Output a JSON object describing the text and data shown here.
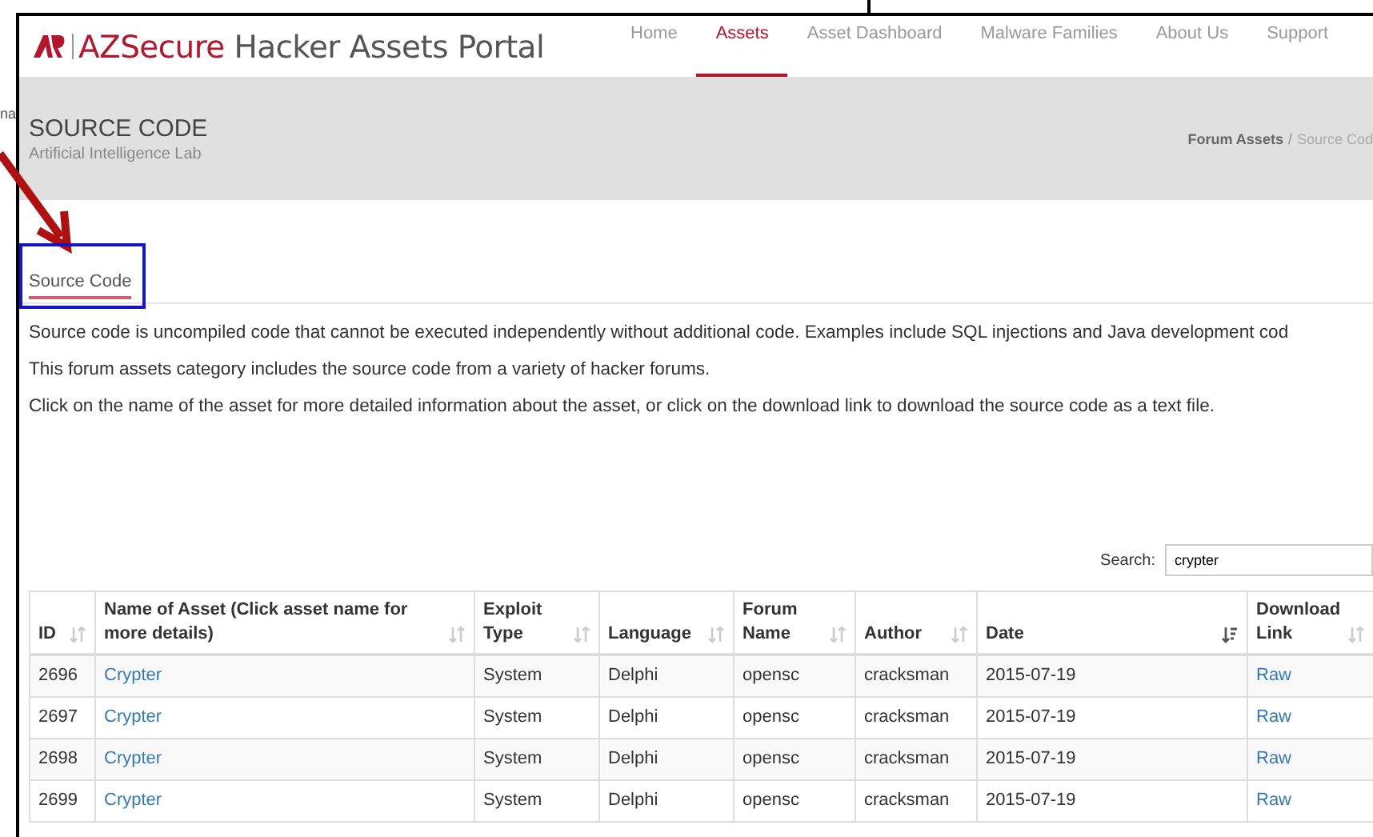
{
  "outside_text": "na",
  "brand": {
    "name": "AZSecure",
    "title": "Hacker Assets Portal"
  },
  "nav": [
    {
      "label": "Home",
      "selected": false
    },
    {
      "label": "Assets",
      "selected": true
    },
    {
      "label": "Asset Dashboard",
      "selected": false
    },
    {
      "label": "Malware Families",
      "selected": false
    },
    {
      "label": "About Us",
      "selected": false
    },
    {
      "label": "Support",
      "selected": false
    }
  ],
  "page_header": {
    "title": "SOURCE CODE",
    "subtitle": "Artificial Intelligence Lab",
    "breadcrumb_separator": "/",
    "breadcrumb": [
      {
        "label": "Forum Assets",
        "current": false
      },
      {
        "label": "Source Cod",
        "current": true
      }
    ]
  },
  "tabs": [
    {
      "label": "Source Code",
      "selected": true
    }
  ],
  "paragraphs": [
    "Source code is uncompiled code that cannot be executed independently without additional code. Examples include SQL injections and Java development cod",
    "This forum assets category includes the source code from a variety of hacker forums.",
    "Click on the name of the asset for more detailed information about the asset, or click on the download link to download the source code as a text file."
  ],
  "search": {
    "label": "Search:",
    "value": "crypter"
  },
  "table": {
    "columns": [
      {
        "label": "ID",
        "sorted": false,
        "kind": "text"
      },
      {
        "label": "Name of Asset (Click asset name for more details)",
        "sorted": false,
        "kind": "link"
      },
      {
        "label": "Exploit Type",
        "sorted": false,
        "kind": "text"
      },
      {
        "label": "Language",
        "sorted": false,
        "kind": "text"
      },
      {
        "label": "Forum Name",
        "sorted": false,
        "kind": "text"
      },
      {
        "label": "Author",
        "sorted": false,
        "kind": "text"
      },
      {
        "label": "Date",
        "sorted": true,
        "kind": "text"
      },
      {
        "label": "Download Link",
        "sorted": false,
        "kind": "link"
      }
    ],
    "rows": [
      [
        "2696",
        "Crypter",
        "System",
        "Delphi",
        "opensc",
        "cracksman",
        "2015-07-19",
        "Raw"
      ],
      [
        "2697",
        "Crypter",
        "System",
        "Delphi",
        "opensc",
        "cracksman",
        "2015-07-19",
        "Raw"
      ],
      [
        "2698",
        "Crypter",
        "System",
        "Delphi",
        "opensc",
        "cracksman",
        "2015-07-19",
        "Raw"
      ],
      [
        "2699",
        "Crypter",
        "System",
        "Delphi",
        "opensc",
        "cracksman",
        "2015-07-19",
        "Raw"
      ]
    ]
  }
}
